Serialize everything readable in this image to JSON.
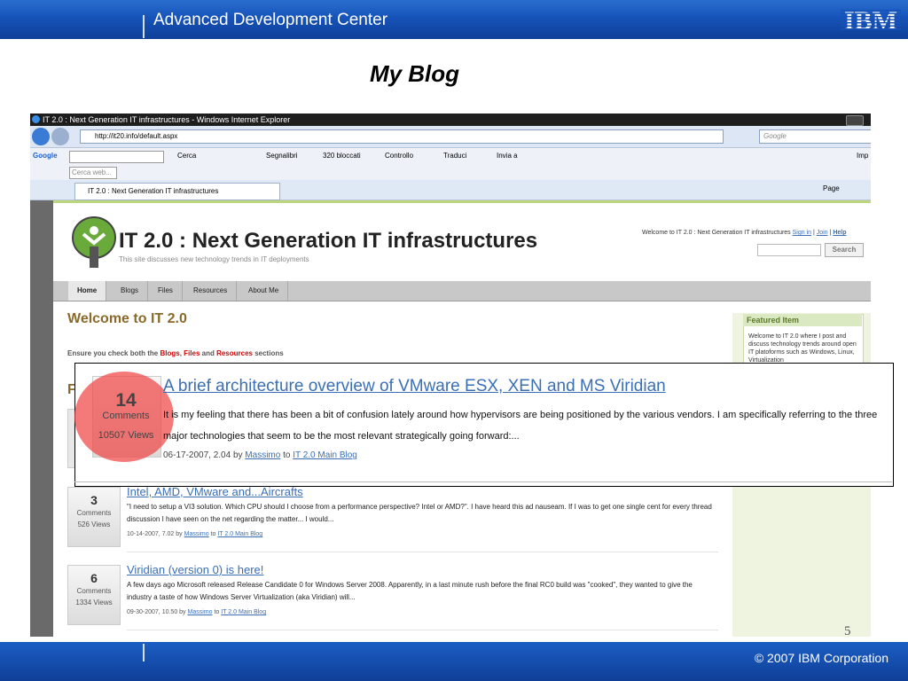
{
  "slide": {
    "header_title": "Advanced Development Center",
    "logo_text": "IBM",
    "title": "My Blog",
    "page_number": "5",
    "copyright": "© 2007 IBM Corporation"
  },
  "browser": {
    "window_title": "IT 2.0 : Next Generation IT infrastructures - Windows Internet Explorer",
    "url": "http://it20.info/default.aspx",
    "search_placeholder": "Google",
    "google_bar": {
      "logo": "Google",
      "search_button": "Cerca",
      "bookmarks": "Segnalibri",
      "blocked": "320 bloccati",
      "check": "Controllo",
      "translate": "Traduci",
      "send": "Invia a",
      "imp": "Imp"
    },
    "search_bar_placeholder": "Cerca web...",
    "tab_title": "IT 2.0 : Next Generation IT infrastructures",
    "page_menu": "Page"
  },
  "site": {
    "title": "IT 2.0 :  Next Generation IT infrastructures",
    "subtitle": "This site discusses new technology trends in IT deployments",
    "welcome_text": "Welcome to IT 2.0 :  Next Generation IT infrastructures",
    "sign_in": "Sign in",
    "join": "Join",
    "help": "Help",
    "search_button": "Search",
    "nav": [
      "Home",
      "Blogs",
      "Files",
      "Resources",
      "About Me"
    ],
    "welcome_heading": "Welcome to IT 2.0",
    "ensure": {
      "prefix": "Ensure you check both the ",
      "blogs": "Blogs",
      "comma": ", ",
      "files": "Files",
      "and": " and ",
      "resources": "Resources",
      "suffix": " sections"
    },
    "featured_heading": "Featured Item",
    "featured_text": "Welcome to IT 2.0 where I post and discuss technology trends around open IT platoforms such as Windows, Linux, Virtualization",
    "partial_heading": "F",
    "posts": [
      {
        "comments": "3",
        "comments_label": "Comments",
        "views": "526 Views",
        "title": "Intel, AMD, VMware and...Aircrafts",
        "body": "\"I need to setup a VI3 solution. Which CPU should I choose from a performance perspective? Intel or AMD?\". I have heard this ad nauseam. If I was to get one single cent for every thread discussion I have seen on the net regarding the matter... I would...",
        "date": "10-14-2007, 7.02 by ",
        "author": "Massimo",
        "to": " to ",
        "blog": "IT 2.0 Main Blog"
      },
      {
        "comments": "6",
        "comments_label": "Comments",
        "views": "1334 Views",
        "title": "Viridian (version 0) is here!",
        "body": "A few days ago Microsoft released Release Candidate 0 for Windows Server 2008. Apparently, in a last minute rush before the final RC0 build was \"cooked\", they wanted to give the industry a taste of how Windows Server Virtualization (aka Viridian) will...",
        "date": "09-30-2007, 10.50 by ",
        "author": "Massimo",
        "to": " to ",
        "blog": "IT 2.0 Main Blog"
      }
    ]
  },
  "zoom": {
    "comments": "14",
    "comments_label": "Comments",
    "views": "10507 Views",
    "title": "A brief architecture overview of VMware ESX, XEN and MS Viridian",
    "body": "It is my feeling that there has been a bit of confusion lately around how hypervisors are being positioned by the various vendors. I am specifically referring to the three major technologies that seem to be the most relevant strategically going forward:...",
    "date": "06-17-2007, 2.04 by ",
    "author": "Massimo",
    "to": " to ",
    "blog": "IT 2.0 Main Blog"
  },
  "colors": {
    "ibm_blue": "#1653b8",
    "highlight_red": "#f04646",
    "link_blue": "#3a6fb6",
    "heading_brown": "#8a6a2a"
  }
}
